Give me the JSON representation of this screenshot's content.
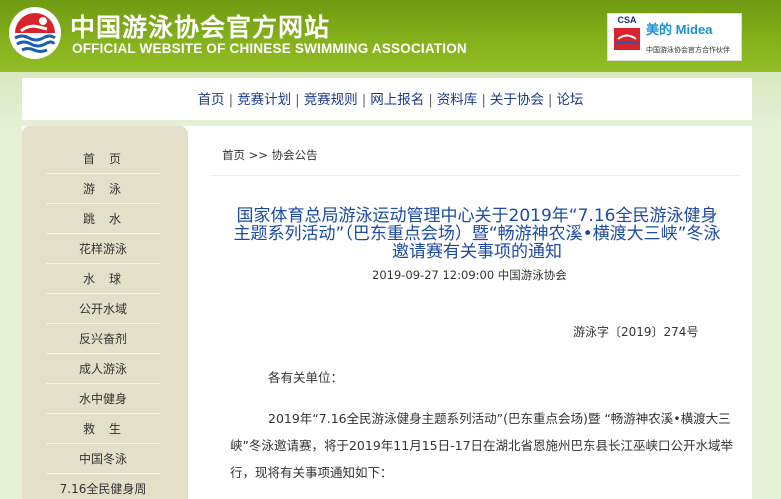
{
  "header": {
    "title": "中国游泳协会官方网站",
    "subtitle": "OFFICIAL WEBSITE OF CHINESE SWIMMING ASSOCIATION",
    "sponsor": {
      "csa_text": "CSA",
      "brand": "美的 Midea",
      "tagline": "中国游泳协会官方合作伙伴"
    },
    "colors": {
      "header_green": "#86b21c",
      "nav_text": "#1a3a8a",
      "title_blue": "#1c4aa6"
    }
  },
  "nav": {
    "items": [
      "首页",
      "竞赛计划",
      "竞赛规则",
      "网上报名",
      "资料库",
      "关于协会",
      "论坛"
    ],
    "separator": "|"
  },
  "sidebar": {
    "items": [
      "首页",
      "游泳",
      "跳水",
      "花样游泳",
      "水球",
      "公开水域",
      "反兴奋剂",
      "成人游泳",
      "水中健身",
      "救生",
      "中国冬泳",
      "7.16全民健身周"
    ]
  },
  "breadcrumb": {
    "home": "首页",
    "separator": ">>",
    "current": "协会公告"
  },
  "article": {
    "title": "国家体育总局游泳运动管理中心关于2019年“7.16全民游泳健身主题系列活动”（巴东重点会场）暨“畅游神农溪•横渡大三峡”冬泳邀请赛有关事项的通知",
    "meta": "2019-09-27 12:09:00 中国游泳协会",
    "doc_number": "游泳字〔2019〕274号",
    "salutation": "各有关单位：",
    "paragraph": "2019年“7.16全民游泳健身主题系列活动”(巴东重点会场)暨 “畅游神农溪•横渡大三峡”冬泳邀请赛，将于2019年11月15日-17日在湖北省恩施州巴东县长江巫峡口公开水域举行，现将有关事项通知如下："
  }
}
